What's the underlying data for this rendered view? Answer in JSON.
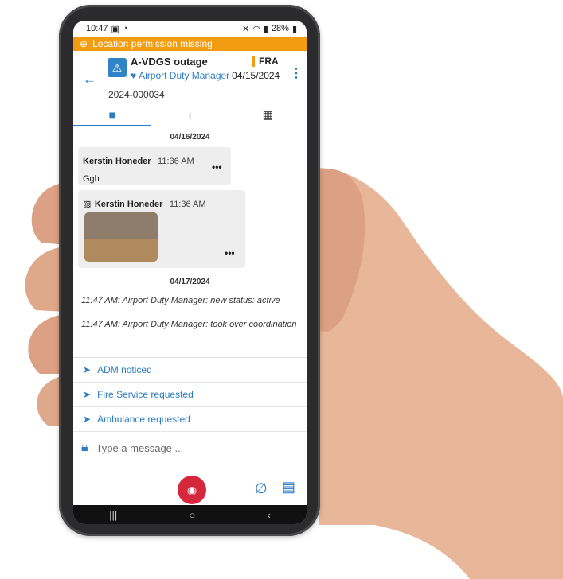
{
  "status": {
    "time": "10:47",
    "battery": "28%"
  },
  "banner": {
    "text": "Location permission missing"
  },
  "header": {
    "title": "A-VDGS outage",
    "badge": "FRA",
    "role": "Airport Duty Manager",
    "date": "04/15/2024",
    "incident_id": "2024-000034"
  },
  "tabs": [
    "chat-tab",
    "info-tab",
    "map-tab"
  ],
  "chat": {
    "date1": "04/16/2024",
    "msg1": {
      "author": "Kerstin Honeder",
      "time": "11:36 AM",
      "text": "Ggh"
    },
    "msg2": {
      "author": "Kerstin Honeder",
      "time": "11:36 AM"
    },
    "date2": "04/17/2024",
    "sys1": "11:47 AM: Airport Duty Manager: new status: active",
    "sys2": "11:47 AM: Airport Duty Manager: took over coordination"
  },
  "actions": [
    "ADM noticed",
    "Fire Service requested",
    "Ambulance requested"
  ],
  "composer": {
    "placeholder": "Type a message ..."
  }
}
